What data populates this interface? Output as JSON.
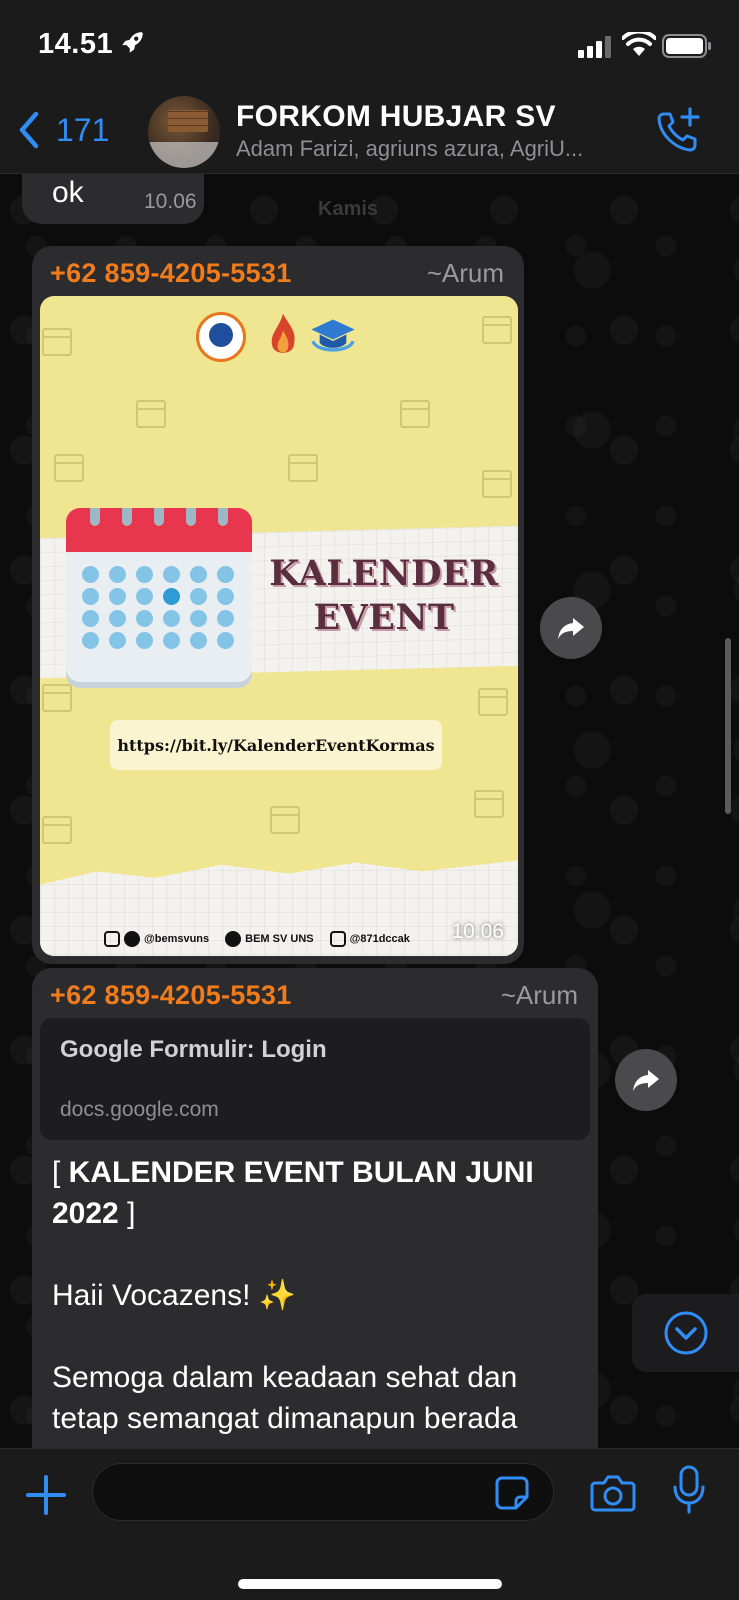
{
  "status_bar": {
    "time": "14.51"
  },
  "header": {
    "back_count": "171",
    "title": "FORKOM HUBJAR SV",
    "subtitle": "Adam Farizi, agriuns azura, AgriU..."
  },
  "chat": {
    "date_chip": "Kamis",
    "messages": [
      {
        "text": "ok",
        "time": "10.06"
      },
      {
        "sender": "+62 859-4205-5531",
        "alias": "~Arum",
        "time": "10.06",
        "poster": {
          "title_line1": "KALENDER",
          "title_line2": "EVENT",
          "url": "https://bit.ly/KalenderEventKormas",
          "social_1": "@bemsvuns",
          "social_2": "BEM SV UNS",
          "social_3": "@871dccak"
        }
      },
      {
        "sender": "+62 859-4205-5531",
        "alias": "~Arum",
        "link_title": "Google Formulir: Login",
        "link_domain": "docs.google.com",
        "line_1_open": "[ ",
        "line_1_bold": "KALENDER EVENT BULAN JUNI 2022",
        "line_1_close": " ]",
        "line_2": "Haii Vocazens! ✨",
        "line_3": "Semoga dalam keadaan sehat dan tetap semangat dimanapun berada"
      }
    ]
  },
  "input": {
    "placeholder": ""
  },
  "colors": {
    "accent": "#2f8df5",
    "sender": "#f07c1c",
    "bubble": "#2c2c2e"
  }
}
